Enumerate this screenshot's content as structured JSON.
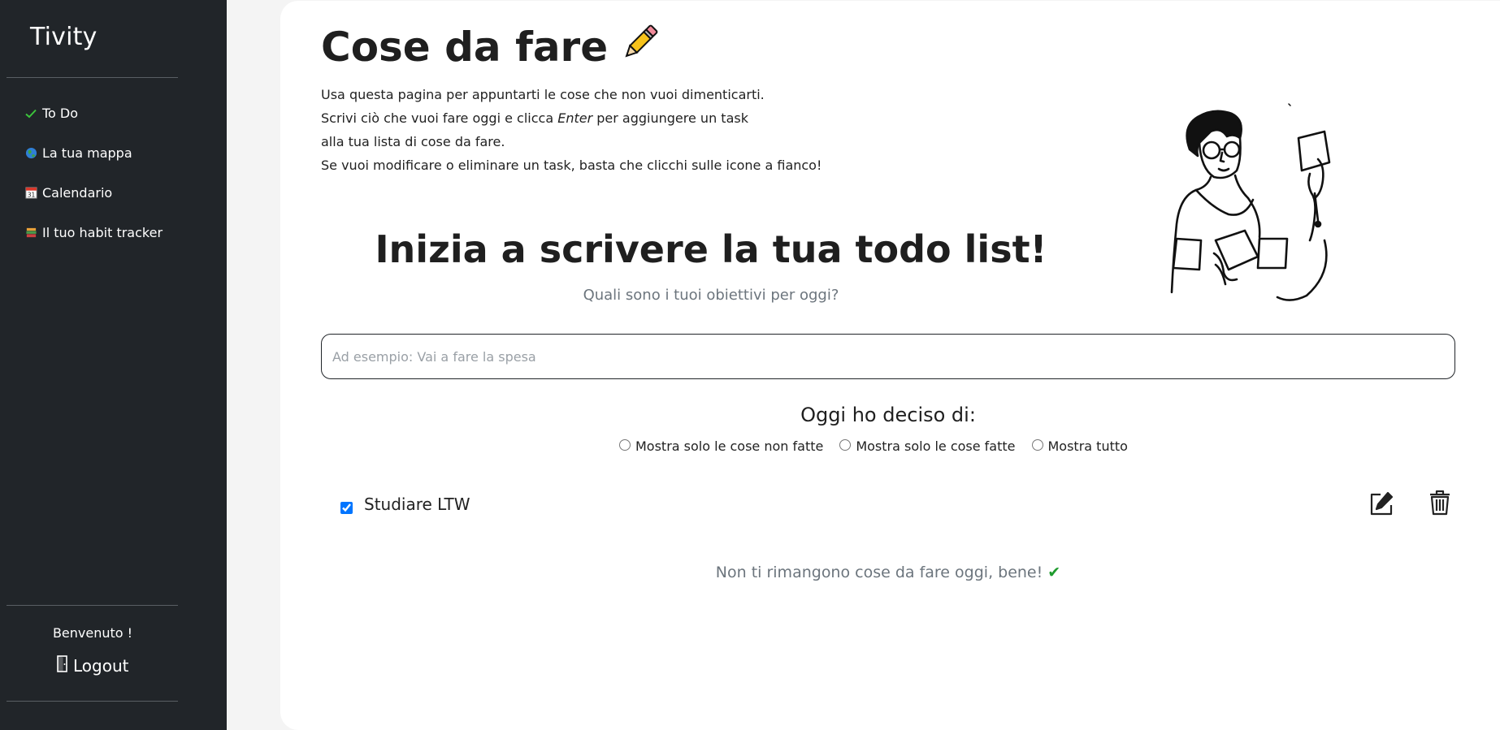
{
  "sidebar": {
    "brand": "Tivity",
    "items": [
      {
        "icon": "check-icon",
        "label": "To Do"
      },
      {
        "icon": "globe-icon",
        "label": "La tua mappa"
      },
      {
        "icon": "calendar-icon",
        "label": "Calendario"
      },
      {
        "icon": "books-icon",
        "label": "Il tuo habit tracker"
      }
    ],
    "welcome": "Benvenuto !",
    "logout": "Logout"
  },
  "main": {
    "title": "Cose da fare",
    "intro": {
      "line1": "Usa questa pagina per appuntarti le cose che non vuoi dimenticarti.",
      "line2_pre": "Scrivi ciò che vuoi fare oggi e clicca ",
      "line2_em": "Enter",
      "line2_post": " per aggiungere un task",
      "line3": "alla tua lista di cose da fare.",
      "line4": "Se vuoi modificare o eliminare un task, basta che clicchi sulle icone a fianco!"
    },
    "heading": "Inizia a scrivere la tua todo list!",
    "subtitle": "Quali sono i tuoi obiettivi per oggi?",
    "input": {
      "placeholder": "Ad esempio: Vai a fare la spesa",
      "value": ""
    },
    "decided_label": "Oggi ho deciso di:",
    "filters": [
      {
        "label": "Mostra solo le cose non fatte",
        "selected": false
      },
      {
        "label": "Mostra solo le cose fatte",
        "selected": false
      },
      {
        "label": "Mostra tutto",
        "selected": false
      }
    ],
    "tasks": [
      {
        "text": "Studiare LTW",
        "done": true
      }
    ],
    "done_message": "Non ti rimangono cose da fare oggi, bene!",
    "done_check": "✔"
  },
  "colors": {
    "sidebar_bg": "#212529",
    "page_bg": "#f4f4f4",
    "card_bg": "#ffffff",
    "accent_check": "#1f9b2e",
    "muted_text": "#6c757d"
  }
}
